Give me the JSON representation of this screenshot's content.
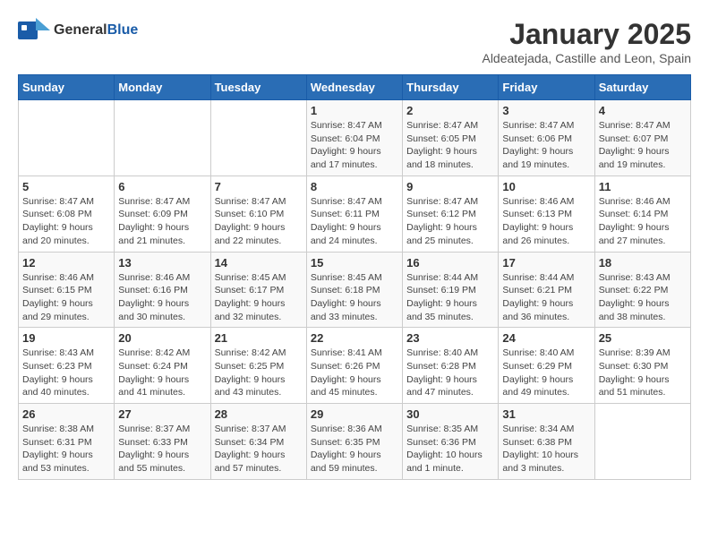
{
  "logo": {
    "general": "General",
    "blue": "Blue"
  },
  "title": "January 2025",
  "subtitle": "Aldeatejada, Castille and Leon, Spain",
  "days_of_week": [
    "Sunday",
    "Monday",
    "Tuesday",
    "Wednesday",
    "Thursday",
    "Friday",
    "Saturday"
  ],
  "weeks": [
    [
      {
        "day": "",
        "info": ""
      },
      {
        "day": "",
        "info": ""
      },
      {
        "day": "",
        "info": ""
      },
      {
        "day": "1",
        "info": "Sunrise: 8:47 AM\nSunset: 6:04 PM\nDaylight: 9 hours and 17 minutes."
      },
      {
        "day": "2",
        "info": "Sunrise: 8:47 AM\nSunset: 6:05 PM\nDaylight: 9 hours and 18 minutes."
      },
      {
        "day": "3",
        "info": "Sunrise: 8:47 AM\nSunset: 6:06 PM\nDaylight: 9 hours and 19 minutes."
      },
      {
        "day": "4",
        "info": "Sunrise: 8:47 AM\nSunset: 6:07 PM\nDaylight: 9 hours and 19 minutes."
      }
    ],
    [
      {
        "day": "5",
        "info": "Sunrise: 8:47 AM\nSunset: 6:08 PM\nDaylight: 9 hours and 20 minutes."
      },
      {
        "day": "6",
        "info": "Sunrise: 8:47 AM\nSunset: 6:09 PM\nDaylight: 9 hours and 21 minutes."
      },
      {
        "day": "7",
        "info": "Sunrise: 8:47 AM\nSunset: 6:10 PM\nDaylight: 9 hours and 22 minutes."
      },
      {
        "day": "8",
        "info": "Sunrise: 8:47 AM\nSunset: 6:11 PM\nDaylight: 9 hours and 24 minutes."
      },
      {
        "day": "9",
        "info": "Sunrise: 8:47 AM\nSunset: 6:12 PM\nDaylight: 9 hours and 25 minutes."
      },
      {
        "day": "10",
        "info": "Sunrise: 8:46 AM\nSunset: 6:13 PM\nDaylight: 9 hours and 26 minutes."
      },
      {
        "day": "11",
        "info": "Sunrise: 8:46 AM\nSunset: 6:14 PM\nDaylight: 9 hours and 27 minutes."
      }
    ],
    [
      {
        "day": "12",
        "info": "Sunrise: 8:46 AM\nSunset: 6:15 PM\nDaylight: 9 hours and 29 minutes."
      },
      {
        "day": "13",
        "info": "Sunrise: 8:46 AM\nSunset: 6:16 PM\nDaylight: 9 hours and 30 minutes."
      },
      {
        "day": "14",
        "info": "Sunrise: 8:45 AM\nSunset: 6:17 PM\nDaylight: 9 hours and 32 minutes."
      },
      {
        "day": "15",
        "info": "Sunrise: 8:45 AM\nSunset: 6:18 PM\nDaylight: 9 hours and 33 minutes."
      },
      {
        "day": "16",
        "info": "Sunrise: 8:44 AM\nSunset: 6:19 PM\nDaylight: 9 hours and 35 minutes."
      },
      {
        "day": "17",
        "info": "Sunrise: 8:44 AM\nSunset: 6:21 PM\nDaylight: 9 hours and 36 minutes."
      },
      {
        "day": "18",
        "info": "Sunrise: 8:43 AM\nSunset: 6:22 PM\nDaylight: 9 hours and 38 minutes."
      }
    ],
    [
      {
        "day": "19",
        "info": "Sunrise: 8:43 AM\nSunset: 6:23 PM\nDaylight: 9 hours and 40 minutes."
      },
      {
        "day": "20",
        "info": "Sunrise: 8:42 AM\nSunset: 6:24 PM\nDaylight: 9 hours and 41 minutes."
      },
      {
        "day": "21",
        "info": "Sunrise: 8:42 AM\nSunset: 6:25 PM\nDaylight: 9 hours and 43 minutes."
      },
      {
        "day": "22",
        "info": "Sunrise: 8:41 AM\nSunset: 6:26 PM\nDaylight: 9 hours and 45 minutes."
      },
      {
        "day": "23",
        "info": "Sunrise: 8:40 AM\nSunset: 6:28 PM\nDaylight: 9 hours and 47 minutes."
      },
      {
        "day": "24",
        "info": "Sunrise: 8:40 AM\nSunset: 6:29 PM\nDaylight: 9 hours and 49 minutes."
      },
      {
        "day": "25",
        "info": "Sunrise: 8:39 AM\nSunset: 6:30 PM\nDaylight: 9 hours and 51 minutes."
      }
    ],
    [
      {
        "day": "26",
        "info": "Sunrise: 8:38 AM\nSunset: 6:31 PM\nDaylight: 9 hours and 53 minutes."
      },
      {
        "day": "27",
        "info": "Sunrise: 8:37 AM\nSunset: 6:33 PM\nDaylight: 9 hours and 55 minutes."
      },
      {
        "day": "28",
        "info": "Sunrise: 8:37 AM\nSunset: 6:34 PM\nDaylight: 9 hours and 57 minutes."
      },
      {
        "day": "29",
        "info": "Sunrise: 8:36 AM\nSunset: 6:35 PM\nDaylight: 9 hours and 59 minutes."
      },
      {
        "day": "30",
        "info": "Sunrise: 8:35 AM\nSunset: 6:36 PM\nDaylight: 10 hours and 1 minute."
      },
      {
        "day": "31",
        "info": "Sunrise: 8:34 AM\nSunset: 6:38 PM\nDaylight: 10 hours and 3 minutes."
      },
      {
        "day": "",
        "info": ""
      }
    ]
  ]
}
